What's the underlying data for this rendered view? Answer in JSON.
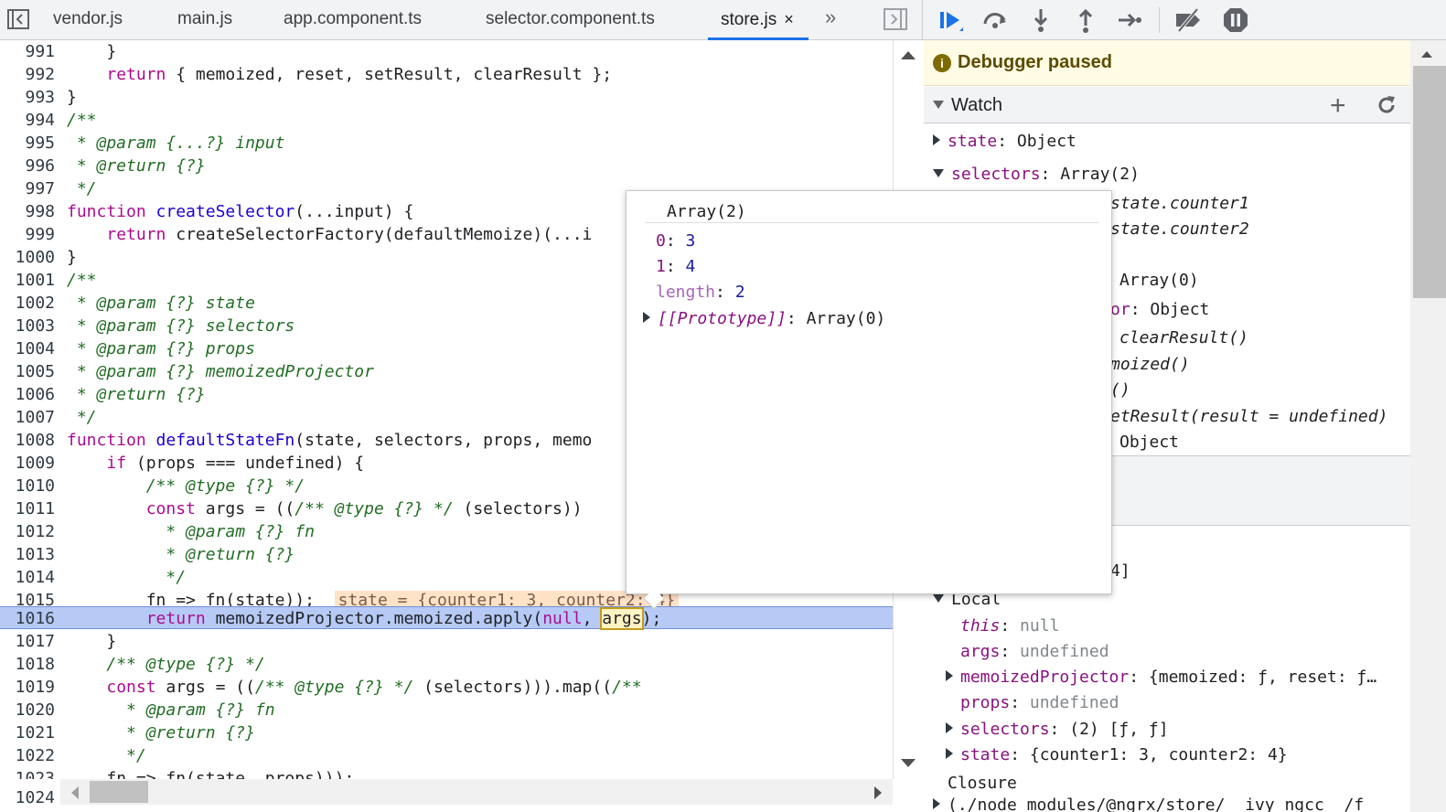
{
  "tabs": [
    {
      "label": "vendor.js"
    },
    {
      "label": "main.js"
    },
    {
      "label": "app.component.ts"
    },
    {
      "label": "selector.component.ts"
    },
    {
      "label": "store.js",
      "active": true,
      "close": "×"
    }
  ],
  "more_tabs": "»",
  "code_lines": [
    {
      "n": "991"
    },
    {
      "n": "992"
    },
    {
      "n": "993"
    },
    {
      "n": "994"
    },
    {
      "n": "995"
    },
    {
      "n": "996"
    },
    {
      "n": "997"
    },
    {
      "n": "998"
    },
    {
      "n": "999"
    },
    {
      "n": "1000"
    },
    {
      "n": "1001"
    },
    {
      "n": "1002"
    },
    {
      "n": "1003"
    },
    {
      "n": "1004"
    },
    {
      "n": "1005"
    },
    {
      "n": "1006"
    },
    {
      "n": "1007"
    },
    {
      "n": "1008"
    },
    {
      "n": "1009"
    },
    {
      "n": "1010"
    },
    {
      "n": "1011"
    },
    {
      "n": "1012"
    },
    {
      "n": "1013"
    },
    {
      "n": "1014"
    },
    {
      "n": "1015"
    },
    {
      "n": "1016"
    },
    {
      "n": "1017"
    },
    {
      "n": "1018"
    },
    {
      "n": "1019"
    },
    {
      "n": "1020"
    },
    {
      "n": "1021"
    },
    {
      "n": "1022"
    },
    {
      "n": "1023"
    },
    {
      "n": "1024"
    }
  ],
  "code": {
    "l991": "    }",
    "l992_kw": "return",
    "l992_rest": " { memoized, reset, setResult, clearResult };",
    "l993": "}",
    "l994": "/**",
    "l995": " * @param {...?} input",
    "l996": " * @return {?}",
    "l997": " */",
    "l998_kw": "function",
    "l998_fn": "createSelector",
    "l998_rest": "(...input) {",
    "l999_kw": "return",
    "l999_rest": " createSelectorFactory(defaultMemoize)(...i",
    "l1000": "}",
    "l1001": "/**",
    "l1002": " * @param {?} state",
    "l1003": " * @param {?} selectors",
    "l1004": " * @param {?} props",
    "l1005": " * @param {?} memoizedProjector",
    "l1006": " * @return {?}",
    "l1007": " */",
    "l1008_kw": "function",
    "l1008_fn": "defaultStateFn",
    "l1008_rest": "(state, selectors, props, memo",
    "l1009_kw": "if",
    "l1009_rest": " (props === undefined) {",
    "l1010": "/** @type {?} */",
    "l1011_kw": "const",
    "l1011_rest": " args = ((",
    "l1011_cm": "/** @type {?} */",
    "l1011_tail": " (selectors))",
    "l1012": " * @param {?} fn",
    "l1013": " * @return {?}",
    "l1014": " */",
    "l1015_code": "fn => fn(state));",
    "l1015_inline": "state = {counter1: 3, counter2: 4}",
    "l1016_kw": "return",
    "l1016_pre": " memoizedProjector.memoized.apply(",
    "l1016_null": "null",
    "l1016_mid": ", ",
    "l1016_args": "args",
    "l1016_end": ");",
    "l1017": "}",
    "l1018": "/** @type {?} */",
    "l1019_kw": "const",
    "l1019_rest": " args = ((",
    "l1019_cm": "/** @type {?} */",
    "l1019_tail": " (selectors))).map((",
    "l1019_cm2": "/**",
    "l1020": " * @param {?} fn",
    "l1021": " * @return {?}",
    "l1022": " */",
    "l1023": "fn => fn(state, props)));"
  },
  "debugger": {
    "paused_text": "Debugger paused",
    "watch_label": "Watch",
    "watch": {
      "state_key": "state",
      "state_val": "Object",
      "selectors_key": "selectors",
      "selectors_val": "Array(2)",
      "sel0": "state.counter1",
      "sel1": "state.counter2",
      "proto": "Array(0)",
      "projector_tail": "or",
      "projector_val": "Object",
      "m_clear": "clearResult()",
      "m_memo": "moized()",
      "m_reset": "()",
      "m_set": "etResult(result = undefined)",
      "m_proto": "Object",
      "partial": "4]"
    },
    "local_label": "Local",
    "locals": [
      {
        "k": "this",
        "v": "null"
      },
      {
        "k": "args",
        "v": "undefined"
      },
      {
        "k": "memoizedProjector",
        "v": "{memoized: ƒ, reset: ƒ…",
        "expand": true
      },
      {
        "k": "props",
        "v": "undefined"
      },
      {
        "k": "selectors",
        "v": "(2) [ƒ, ƒ]",
        "expand": true
      },
      {
        "k": "state",
        "v": "{counter1: 3, counter2: 4}",
        "expand": true
      }
    ],
    "closure_label": "Closure",
    "closure_path": "(./node_modules/@ngrx/store/__ivy_ngcc__/f"
  },
  "popover": {
    "title": "Array(2)",
    "items": [
      {
        "k": "0",
        "v": "3"
      },
      {
        "k": "1",
        "v": "4"
      },
      {
        "k": "length",
        "v": "2"
      }
    ],
    "proto_key": "[[Prototype]]",
    "proto_val": "Array(0)"
  },
  "colors": {
    "accent": "#1a73e8",
    "paused_bg": "#fffbe5",
    "exec_line": "#b6caf5"
  }
}
